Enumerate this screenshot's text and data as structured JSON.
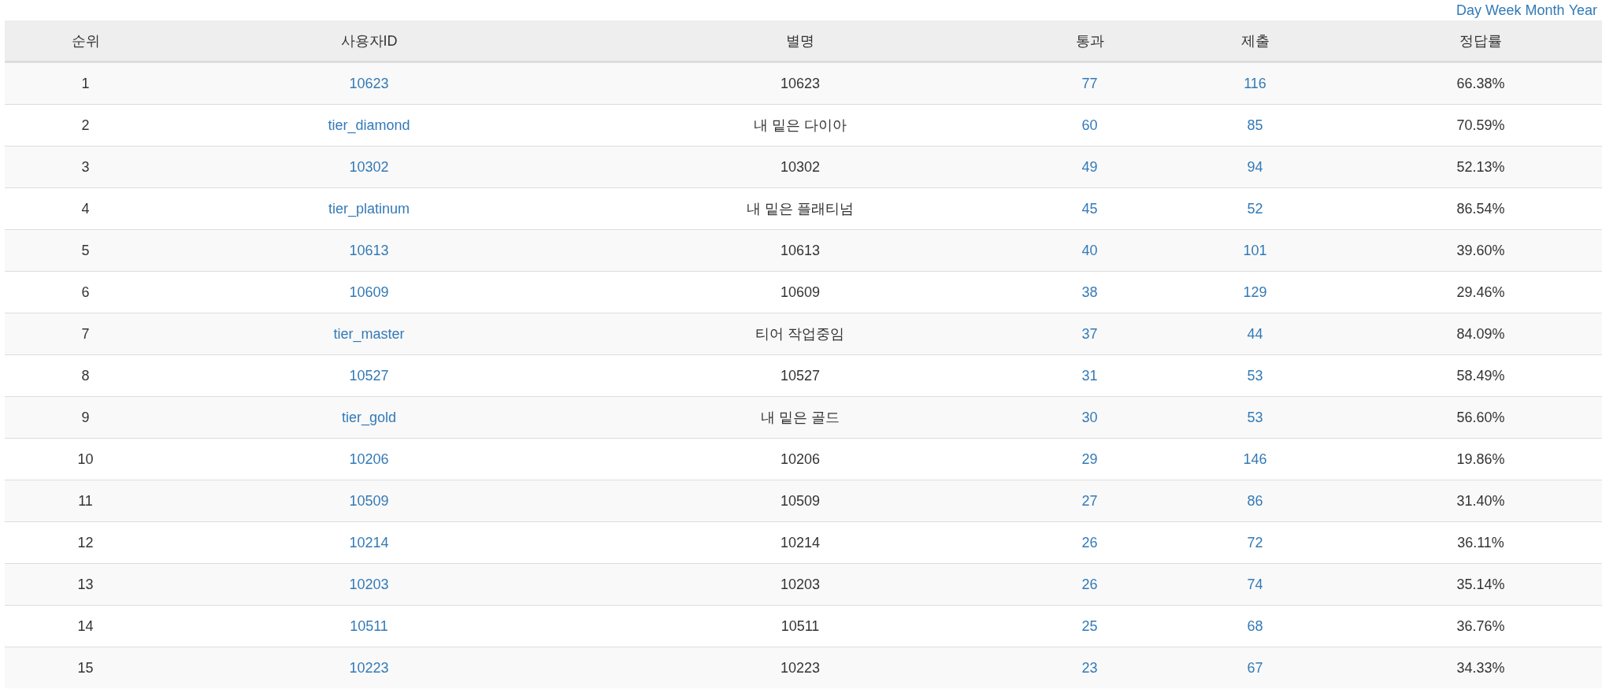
{
  "period_links": [
    "Day",
    "Week",
    "Month",
    "Year"
  ],
  "table": {
    "columns": [
      "순위",
      "사용자ID",
      "별명",
      "통과",
      "제출",
      "정답률"
    ],
    "rows": [
      {
        "rank": "1",
        "user_id": "10623",
        "nickname": "10623",
        "solved": "77",
        "submitted": "116",
        "ratio": "66.38%"
      },
      {
        "rank": "2",
        "user_id": "tier_diamond",
        "nickname": "내 밑은 다이아",
        "solved": "60",
        "submitted": "85",
        "ratio": "70.59%"
      },
      {
        "rank": "3",
        "user_id": "10302",
        "nickname": "10302",
        "solved": "49",
        "submitted": "94",
        "ratio": "52.13%"
      },
      {
        "rank": "4",
        "user_id": "tier_platinum",
        "nickname": "내 밑은 플래티넘",
        "solved": "45",
        "submitted": "52",
        "ratio": "86.54%"
      },
      {
        "rank": "5",
        "user_id": "10613",
        "nickname": "10613",
        "solved": "40",
        "submitted": "101",
        "ratio": "39.60%"
      },
      {
        "rank": "6",
        "user_id": "10609",
        "nickname": "10609",
        "solved": "38",
        "submitted": "129",
        "ratio": "29.46%"
      },
      {
        "rank": "7",
        "user_id": "tier_master",
        "nickname": "티어 작업중임",
        "solved": "37",
        "submitted": "44",
        "ratio": "84.09%"
      },
      {
        "rank": "8",
        "user_id": "10527",
        "nickname": "10527",
        "solved": "31",
        "submitted": "53",
        "ratio": "58.49%"
      },
      {
        "rank": "9",
        "user_id": "tier_gold",
        "nickname": "내 밑은 골드",
        "solved": "30",
        "submitted": "53",
        "ratio": "56.60%"
      },
      {
        "rank": "10",
        "user_id": "10206",
        "nickname": "10206",
        "solved": "29",
        "submitted": "146",
        "ratio": "19.86%"
      },
      {
        "rank": "11",
        "user_id": "10509",
        "nickname": "10509",
        "solved": "27",
        "submitted": "86",
        "ratio": "31.40%"
      },
      {
        "rank": "12",
        "user_id": "10214",
        "nickname": "10214",
        "solved": "26",
        "submitted": "72",
        "ratio": "36.11%"
      },
      {
        "rank": "13",
        "user_id": "10203",
        "nickname": "10203",
        "solved": "26",
        "submitted": "74",
        "ratio": "35.14%"
      },
      {
        "rank": "14",
        "user_id": "10511",
        "nickname": "10511",
        "solved": "25",
        "submitted": "68",
        "ratio": "36.76%"
      },
      {
        "rank": "15",
        "user_id": "10223",
        "nickname": "10223",
        "solved": "23",
        "submitted": "67",
        "ratio": "34.33%"
      }
    ]
  }
}
